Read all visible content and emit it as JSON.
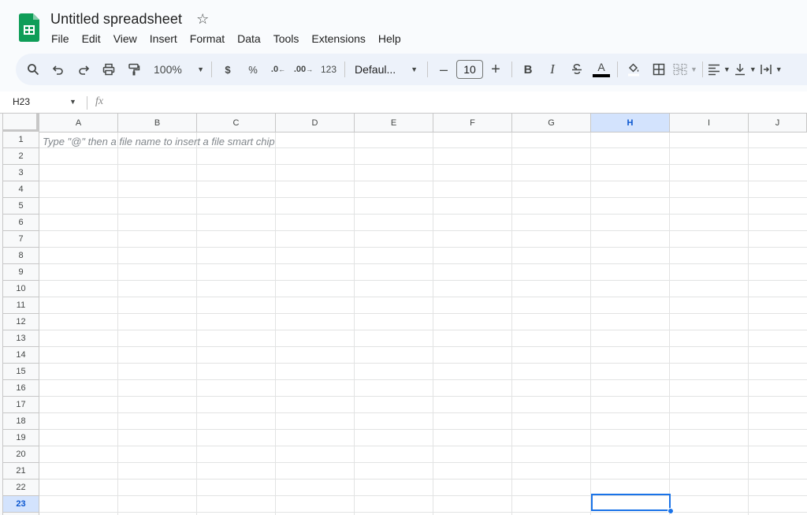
{
  "app": {
    "doc_title": "Untitled spreadsheet",
    "brand_color": "#0f9d58"
  },
  "menu": [
    "File",
    "Edit",
    "View",
    "Insert",
    "Format",
    "Data",
    "Tools",
    "Extensions",
    "Help"
  ],
  "toolbar": {
    "zoom": "100%",
    "currency": "$",
    "percent": "%",
    "decrease_decimal": ".0",
    "increase_decimal": ".00",
    "number_format": "123",
    "font": "Defaul...",
    "font_size": "10",
    "minus": "–",
    "plus": "+",
    "bold": "B",
    "italic": "I",
    "text_color_letter": "A"
  },
  "formula_bar": {
    "cell_ref": "H23",
    "fx": "fx"
  },
  "grid": {
    "columns": [
      "A",
      "B",
      "C",
      "D",
      "E",
      "F",
      "G",
      "H",
      "I",
      "J"
    ],
    "rows": [
      "1",
      "2",
      "3",
      "4",
      "5",
      "6",
      "7",
      "8",
      "9",
      "10",
      "11",
      "12",
      "13",
      "14",
      "15",
      "16",
      "17",
      "18",
      "19",
      "20",
      "21",
      "22",
      "23"
    ],
    "selected_column": "H",
    "selected_row": "23",
    "hint_text": "Type \"@\" then a file name to insert a file smart chip",
    "selection_color": "#1a73e8"
  }
}
